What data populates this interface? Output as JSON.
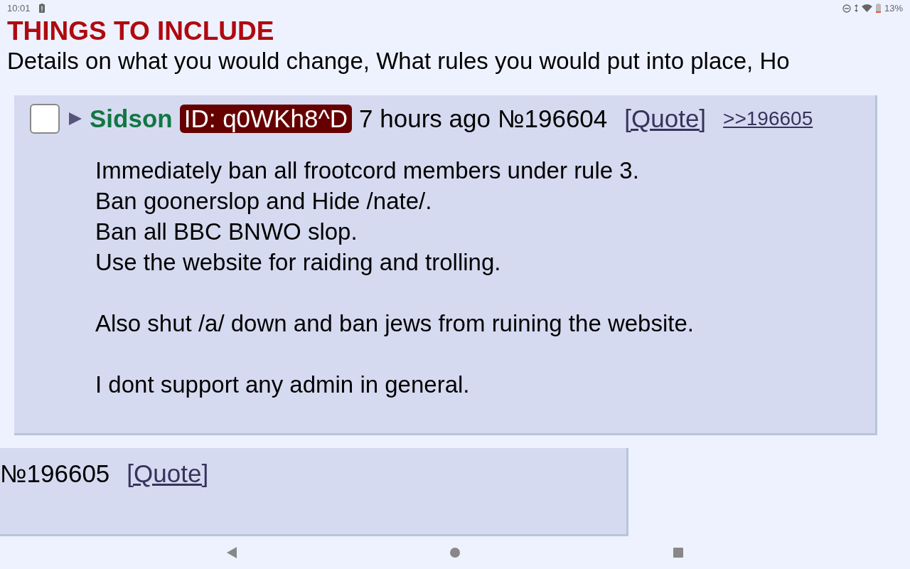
{
  "status_bar": {
    "time": "10:01",
    "battery": "13%"
  },
  "heading": {
    "title": "THINGS TO INCLUDE",
    "subtitle": "Details on what you would change, What rules you would put into place, Ho"
  },
  "posts": [
    {
      "checked": false,
      "name": "Sidson",
      "id": "ID: q0WKh8^D",
      "time": "7 hours ago",
      "number": "№196604",
      "quote": "[Quote]",
      "replies": [
        ">>196605"
      ],
      "paragraphs": [
        [
          "Immediately ban all frootcord members under rule 3.",
          "Ban goonerslop and Hide /nate/.",
          "Ban all BBC BNWO slop.",
          "Use the website for raiding and trolling."
        ],
        [
          "Also shut /a/ down and ban jews from ruining the website."
        ],
        [
          "I dont support any admin in general."
        ]
      ]
    },
    {
      "number": "№196605",
      "quote": "[Quote]"
    }
  ]
}
